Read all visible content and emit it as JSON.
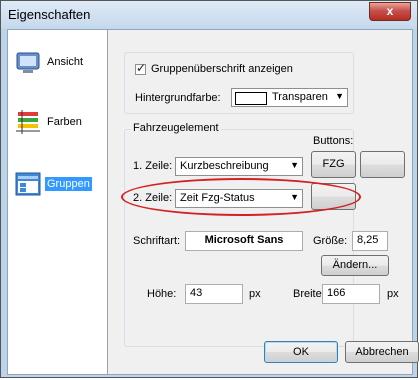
{
  "window": {
    "title": "Eigenschaften",
    "close_glyph": "x"
  },
  "sidebar": {
    "items": [
      {
        "label": "Ansicht",
        "icon": "monitor-icon",
        "selected": false
      },
      {
        "label": "Farben",
        "icon": "color-lines-icon",
        "selected": false
      },
      {
        "label": "Gruppen",
        "icon": "groups-icon",
        "selected": true
      }
    ]
  },
  "header_options": {
    "show_group_header_label": "Gruppenüberschrift anzeigen",
    "show_group_header_checked": true,
    "background_color_label": "Hintergrundfarbe:",
    "background_color_value": "Transparen"
  },
  "vehicle_element": {
    "legend": "Fahrzeugelement",
    "buttons_label": "Buttons:",
    "line1_label": "1. Zeile:",
    "line1_value": "Kurzbeschreibung",
    "line1_button": "FZG",
    "line2_label": "2. Zeile:",
    "line2_value": "Zeit Fzg-Status",
    "font_label": "Schriftart:",
    "font_value": "Microsoft Sans",
    "size_label": "Größe:",
    "size_value": "8,25",
    "change_button": "Ändern...",
    "height_label": "Höhe:",
    "height_value": "43",
    "height_unit": "px",
    "width_label": "Breite:",
    "width_value": "166",
    "width_unit": "px"
  },
  "footer": {
    "ok_label": "OK",
    "cancel_label": "Abbrechen"
  },
  "colors": {
    "highlight_ellipse": "#d42121",
    "selection": "#3399ff"
  }
}
